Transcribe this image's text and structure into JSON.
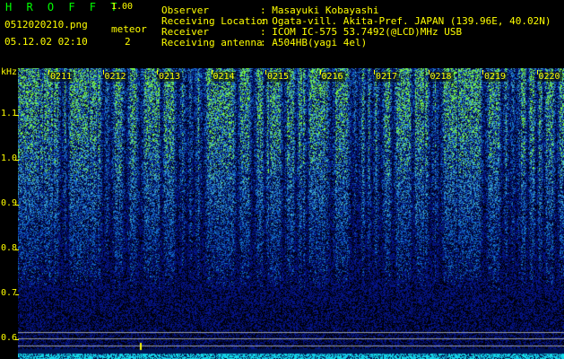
{
  "app": {
    "title": "H R O F F T",
    "version": "1.00"
  },
  "file": {
    "name": "0512020210.png",
    "datetime": "05.12.02 02:10"
  },
  "meteor": {
    "label": "meteor",
    "count": "2"
  },
  "station": {
    "observer_label": "Observer",
    "observer_value": ": Masayuki Kobayashi",
    "location_label": "Receiving Location",
    "location_value": ": Ogata-vill. Akita-Pref. JAPAN (139.96E, 40.02N)",
    "receiver_label": "Receiver",
    "receiver_value": ": ICOM IC-575 53.7492(@LCD)MHz USB",
    "antenna_label": "Receiving antenna",
    "antenna_value": ": A504HB(yagi 4el)"
  },
  "spectrogram": {
    "y_unit": "kHz",
    "y_ticks": [
      "1.1",
      "1.0",
      "0.9",
      "0.8",
      "0.7",
      "0.6"
    ],
    "x_ticks": [
      "0211",
      "0212",
      "0213",
      "0214",
      "0215",
      "0216",
      "0217",
      "0218",
      "0219",
      "0220"
    ],
    "colors": {
      "background": "#000000",
      "low": "#0a1a7a",
      "mid": "#1e5bd8",
      "high": "#5fd3c8",
      "peak": "#7dff3a",
      "baseline": "#1de0ff",
      "marker": "#ffff00"
    }
  }
}
